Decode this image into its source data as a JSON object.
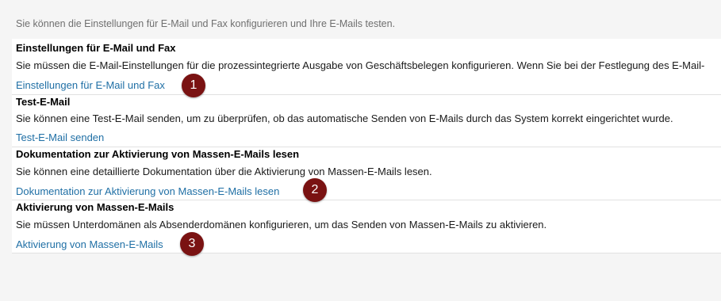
{
  "intro": "Sie können die Einstellungen für E-Mail und Fax konfigurieren und Ihre E-Mails testen.",
  "sections": [
    {
      "title": "Einstellungen für E-Mail und Fax",
      "description": "Sie müssen die E-Mail-Einstellungen für die prozessintegrierte Ausgabe von Geschäftsbelegen konfigurieren. Wenn Sie bei der Festlegung des E-Mail-",
      "link": "Einstellungen für E-Mail und Fax",
      "marker": "1"
    },
    {
      "title": "Test-E-Mail",
      "description": "Sie können eine Test-E-Mail senden, um zu überprüfen, ob das automatische Senden von E-Mails durch das System korrekt eingerichtet wurde.",
      "link": "Test-E-Mail senden",
      "marker": ""
    },
    {
      "title": "Dokumentation zur Aktivierung von Massen-E-Mails lesen",
      "description": "Sie können eine detaillierte Dokumentation über die Aktivierung von Massen-E-Mails lesen.",
      "link": "Dokumentation zur Aktivierung von Massen-E-Mails lesen",
      "marker": "2"
    },
    {
      "title": "Aktivierung von Massen-E-Mails",
      "description": "Sie müssen Unterdomänen als Absenderdomänen konfigurieren, um das Senden von Massen-E-Mails zu aktivieren.",
      "link": "Aktivierung von Massen-E-Mails",
      "marker": "3"
    }
  ]
}
